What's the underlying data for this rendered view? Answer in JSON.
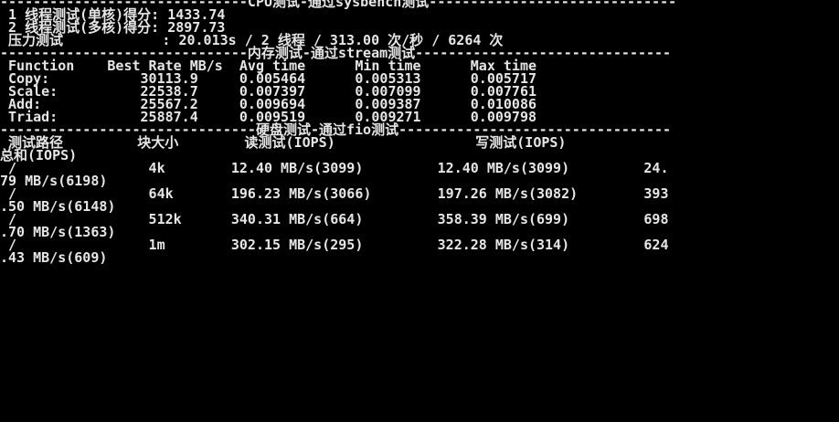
{
  "terminal": {
    "lines": [
      "------------------------------CPU测试-通过sysbench测试------------------------------",
      " 1 线程测试(单核)得分: 1433.74",
      " 2 线程测试(多核)得分: 2897.73",
      " 压力测试            : 20.013s / 2 线程 / 313.00 次/秒 / 6264 次",
      "------------------------------内存测试-通过stream测试-------------------------------",
      " Function    Best Rate MB/s  Avg time      Min time      Max time",
      " Copy:           30113.9     0.005464      0.005313      0.005717",
      " Scale:          22538.7     0.007397      0.007099      0.007761",
      " Add:            25567.2     0.009694      0.009387      0.010086",
      " Triad:          25887.4     0.009519      0.009271      0.009798",
      "-------------------------------硬盘测试-通过fio测试---------------------------------",
      " 测试路径         块大小        读测试(IOPS)                 写测试(IOPS)",
      "总和(IOPS)",
      " /                4k        12.40 MB/s(3099)         12.40 MB/s(3099)         24.",
      "79 MB/s(6198)",
      " /                64k       196.23 MB/s(3066)        197.26 MB/s(3082)        393",
      ".50 MB/s(6148)",
      " /                512k      340.31 MB/s(664)         358.39 MB/s(699)         698",
      ".70 MB/s(1363)",
      " /                1m        302.15 MB/s(295)         322.28 MB/s(314)         624",
      ".43 MB/s(609)"
    ]
  },
  "colors": {
    "background": "#000000",
    "text": "#e6e6e6"
  }
}
